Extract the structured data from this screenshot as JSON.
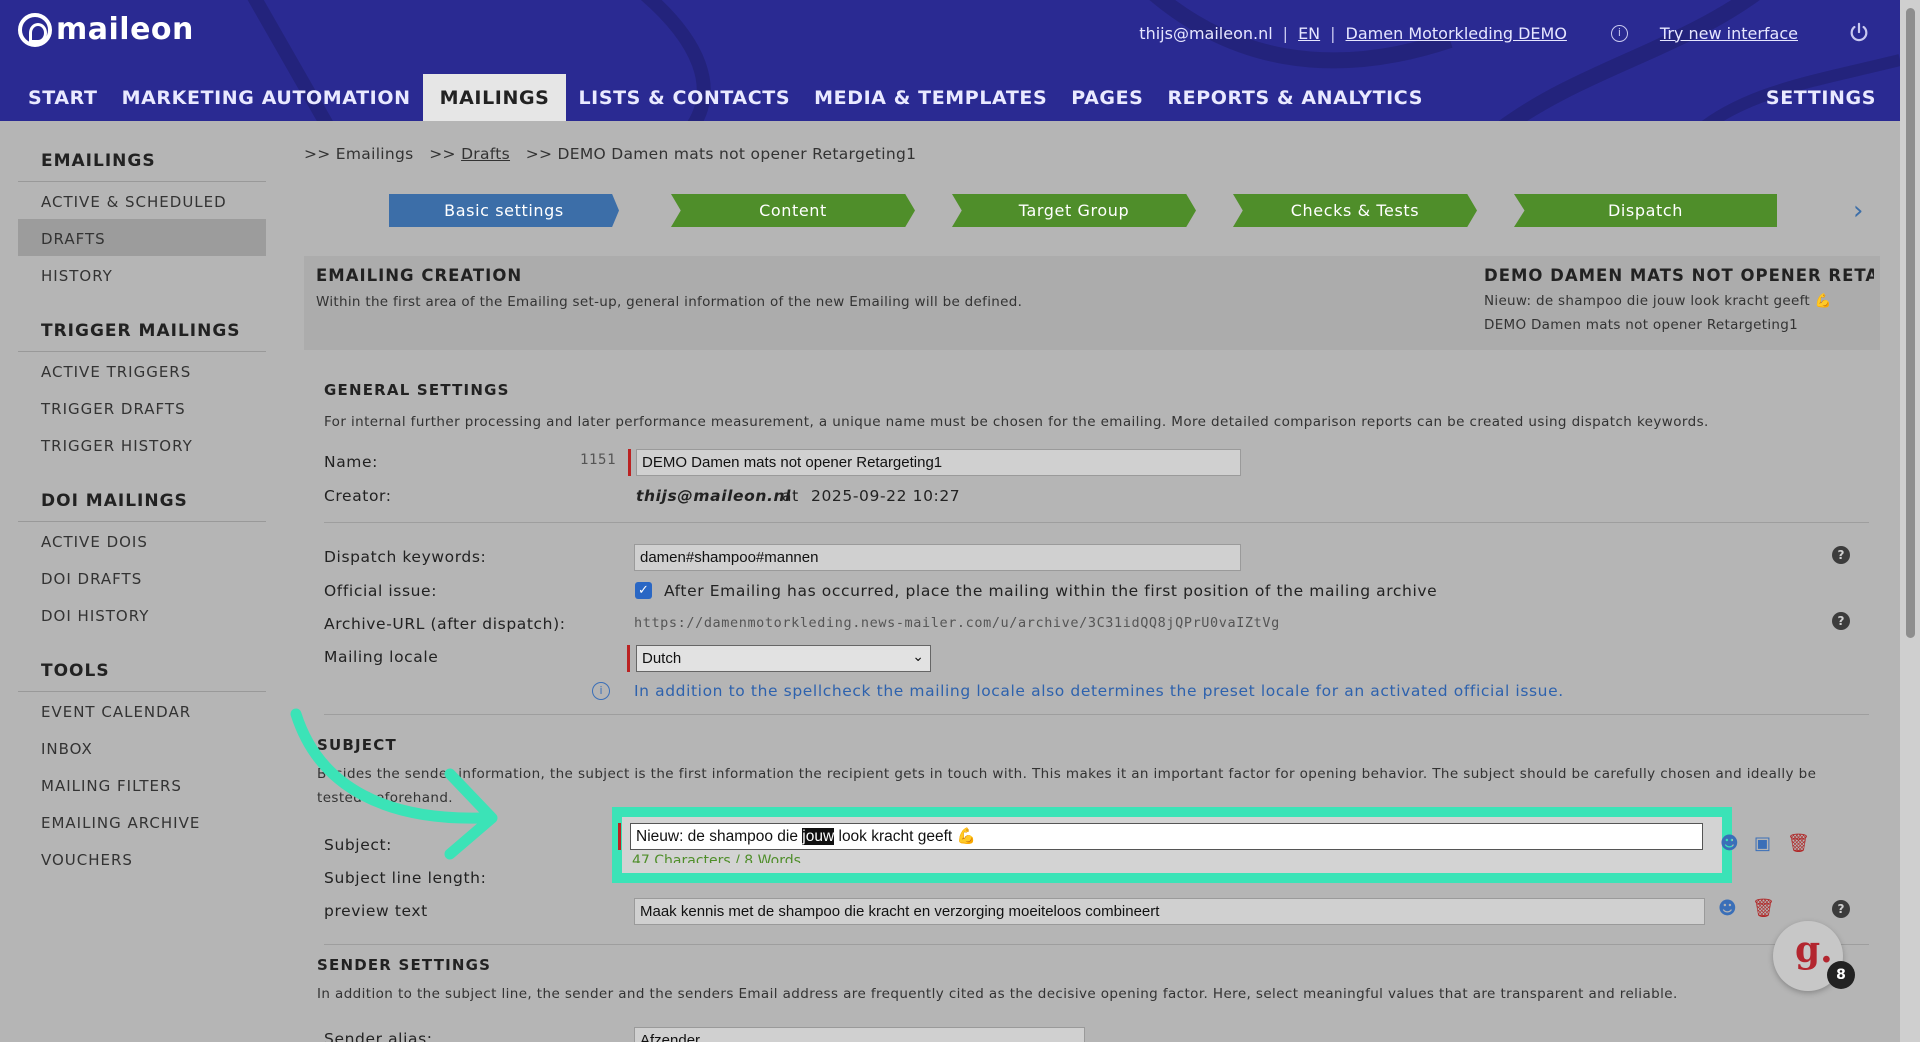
{
  "brand": {
    "logo_text": "maileon"
  },
  "topbar": {
    "user_email": "thijs@maileon.nl",
    "sep1": "|",
    "language": "EN",
    "sep2": "|",
    "account": "Damen Motorkleding DEMO",
    "try_new": "Try new interface"
  },
  "nav": {
    "items": [
      "START",
      "MARKETING AUTOMATION",
      "MAILINGS",
      "LISTS & CONTACTS",
      "MEDIA & TEMPLATES",
      "PAGES",
      "REPORTS & ANALYTICS"
    ],
    "active": "MAILINGS",
    "settings": "SETTINGS"
  },
  "sidebar": {
    "groups": [
      {
        "title": "EMAILINGS",
        "items": [
          "ACTIVE & SCHEDULED",
          "DRAFTS",
          "HISTORY"
        ],
        "active": "DRAFTS"
      },
      {
        "title": "TRIGGER MAILINGS",
        "items": [
          "ACTIVE TRIGGERS",
          "TRIGGER DRAFTS",
          "TRIGGER HISTORY"
        ]
      },
      {
        "title": "DOI MAILINGS",
        "items": [
          "ACTIVE DOIS",
          "DOI DRAFTS",
          "DOI HISTORY"
        ]
      },
      {
        "title": "TOOLS",
        "items": [
          "EVENT CALENDAR",
          "INBOX",
          "MAILING FILTERS",
          "EMAILING ARCHIVE",
          "VOUCHERS"
        ]
      }
    ]
  },
  "breadcrumb": {
    "p1": ">> Emailings",
    "p2_prefix": ">>",
    "p2_link": "Drafts",
    "p3": ">> DEMO Damen mats not opener Retargeting1"
  },
  "steps": [
    "Basic settings",
    "Content",
    "Target Group",
    "Checks & Tests",
    "Dispatch"
  ],
  "creation": {
    "title": "EMAILING CREATION",
    "desc": "Within the first area of the Emailing set-up, general information of the new Emailing will be defined.",
    "summary_title": "DEMO DAMEN MATS NOT OPENER RETA...",
    "summary_subject": "Nieuw: de shampoo die jouw look kracht geeft 💪",
    "summary_name": "DEMO Damen mats not opener Retargeting1"
  },
  "general": {
    "title": "GENERAL SETTINGS",
    "desc": "For internal further processing and later performance measurement, a unique name must be chosen for the emailing. More detailed comparison reports can be created using dispatch keywords.",
    "name_label": "Name:",
    "name_id": "1151",
    "name_value": "DEMO Damen mats not opener Retargeting1",
    "creator_label": "Creator:",
    "creator_email": "thijs@maileon.nl",
    "creator_at": "at",
    "creator_date": "2025-09-22 10:27",
    "keywords_label": "Dispatch keywords:",
    "keywords_value": "damen#shampoo#mannen",
    "official_label": "Official issue:",
    "official_text": "After Emailing has occurred, place the mailing within the first position of the mailing archive",
    "archive_label": "Archive-URL (after dispatch):",
    "archive_url": "https://damenmotorkleding.news-mailer.com/u/archive/3C31idQQ8jQPrU0vaIZtVg",
    "locale_label": "Mailing locale",
    "locale_value": "Dutch",
    "locale_note": "In addition to the spellcheck the mailing locale also determines the preset locale for an activated official issue."
  },
  "subject": {
    "title": "SUBJECT",
    "desc_line1": "Besides the sender information, the subject is the first information the recipient gets in touch with. This makes it an important factor for opening behavior. The subject should be carefully chosen and ideally be",
    "desc_line2": "tested beforehand.",
    "subject_label": "Subject:",
    "subject_pre": "Nieuw: de shampoo die ",
    "subject_sel": "jouw",
    "subject_post": " look kracht geeft 💪",
    "length_label": "Subject line length:",
    "length_value": "47 Characters / 8 Words",
    "preview_label": "preview text",
    "preview_value": "Maak kennis met de shampoo die kracht en verzorging moeiteloos combineert"
  },
  "sender": {
    "title": "SENDER SETTINGS",
    "desc": "In addition to the subject line, the sender and the senders Email address are frequently cited as the decisive opening factor. Here, select meaningful values that are transparent and reliable.",
    "alias_label": "Sender alias:",
    "alias_value": "Afzender"
  },
  "chat": {
    "glyph": "g.",
    "badge": "8"
  },
  "colors": {
    "header": "#2a2a92",
    "highlight": "#3be3b7",
    "step_blue": "#3c6ea8",
    "step_green": "#4f8e2a"
  }
}
